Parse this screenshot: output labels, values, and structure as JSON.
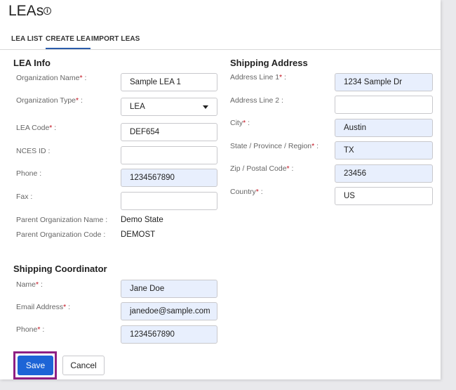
{
  "header": {
    "title": "LEAs",
    "info_icon": "info-icon"
  },
  "tabs": [
    {
      "label": "LEA LIST",
      "active": false
    },
    {
      "label": "CREATE LEA",
      "active": true
    },
    {
      "label": "IMPORT LEAS",
      "active": false
    }
  ],
  "lea_info": {
    "heading": "LEA Info",
    "org_name": {
      "label": "Organization Name",
      "required_mark": "*",
      "suffix": " :",
      "value": "Sample LEA 1"
    },
    "org_type": {
      "label": "Organization Type",
      "required_mark": "*",
      "suffix": " :",
      "value": "LEA"
    },
    "lea_code": {
      "label": "LEA Code",
      "required_mark": "*",
      "suffix": " :",
      "value": "DEF654"
    },
    "nces_id": {
      "label": "NCES ID :",
      "value": ""
    },
    "phone": {
      "label": "Phone :",
      "value": "1234567890"
    },
    "fax": {
      "label": "Fax :",
      "value": ""
    },
    "parent_org_name": {
      "label": "Parent Organization Name :",
      "value": "Demo State"
    },
    "parent_org_code": {
      "label": "Parent Organization Code :",
      "value": "DEMOST"
    }
  },
  "shipping_address": {
    "heading": "Shipping Address",
    "line1": {
      "label": "Address Line 1",
      "required_mark": "*",
      "suffix": " :",
      "value": "1234 Sample Dr"
    },
    "line2": {
      "label": "Address Line 2 :",
      "value": ""
    },
    "city": {
      "label": "City",
      "required_mark": "*",
      "suffix": " :",
      "value": "Austin"
    },
    "state": {
      "label": "State / Province / Region",
      "required_mark": "*",
      "suffix": " :",
      "value": "TX"
    },
    "zip": {
      "label": "Zip / Postal Code",
      "required_mark": "*",
      "suffix": " :",
      "value": "23456"
    },
    "country": {
      "label": "Country",
      "required_mark": "*",
      "suffix": " :",
      "value": "US"
    }
  },
  "shipping_coordinator": {
    "heading": "Shipping Coordinator",
    "name": {
      "label": "Name",
      "required_mark": "*",
      "suffix": " :",
      "value": "Jane Doe"
    },
    "email": {
      "label": "Email Address",
      "required_mark": "*",
      "suffix": " :",
      "value": "janedoe@sample.com"
    },
    "phone": {
      "label": "Phone",
      "required_mark": "*",
      "suffix": " :",
      "value": "1234567890"
    }
  },
  "actions": {
    "save_label": "Save",
    "cancel_label": "Cancel"
  },
  "colors": {
    "accent": "#1d64d6",
    "required": "#c1121f",
    "filled_field": "#e8effd",
    "highlight_outline": "#8e1f83"
  }
}
